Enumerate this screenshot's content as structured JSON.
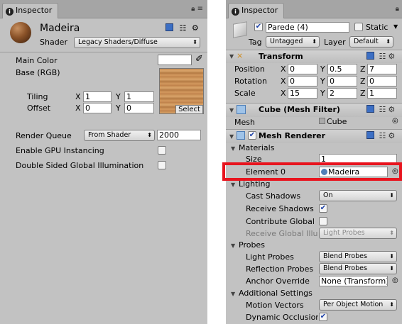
{
  "left": {
    "tab_label": "Inspector",
    "material": {
      "name": "Madeira",
      "shader_label": "Shader",
      "shader_value": "Legacy Shaders/Diffuse"
    },
    "main_color_label": "Main Color",
    "base_label": "Base (RGB)",
    "tiling_label": "Tiling",
    "offset_label": "Offset",
    "x_label": "X",
    "y_label": "Y",
    "tiling_x": "1",
    "tiling_y": "1",
    "offset_x": "0",
    "offset_y": "0",
    "select_label": "Select",
    "render_queue_label": "Render Queue",
    "render_queue_mode": "From Shader",
    "render_queue_value": "2000",
    "gpu_instancing_label": "Enable GPU Instancing",
    "double_sided_label": "Double Sided Global Illumination"
  },
  "right": {
    "tab_label": "Inspector",
    "object_name": "Parede (4)",
    "static_label": "Static",
    "tag_label": "Tag",
    "tag_value": "Untagged",
    "layer_label": "Layer",
    "layer_value": "Default",
    "transform": {
      "title": "Transform",
      "position_label": "Position",
      "rotation_label": "Rotation",
      "scale_label": "Scale",
      "x_label": "X",
      "y_label": "Y",
      "z_label": "Z",
      "position": {
        "x": "0",
        "y": "0.5",
        "z": "7"
      },
      "rotation": {
        "x": "0",
        "y": "0",
        "z": "0"
      },
      "scale": {
        "x": "15",
        "y": "2",
        "z": "1"
      }
    },
    "mesh_filter": {
      "title": "Cube (Mesh Filter)",
      "mesh_label": "Mesh",
      "mesh_value": "Cube"
    },
    "mesh_renderer": {
      "title": "Mesh Renderer",
      "materials_label": "Materials",
      "size_label": "Size",
      "size_value": "1",
      "element0_label": "Element 0",
      "element0_value": "Madeira",
      "lighting_label": "Lighting",
      "cast_shadows_label": "Cast Shadows",
      "cast_shadows_value": "On",
      "receive_shadows_label": "Receive Shadows",
      "contribute_global_label": "Contribute Global",
      "receive_global_label": "Receive Global Illu",
      "receive_global_value": "Light Probes",
      "probes_label": "Probes",
      "light_probes_label": "Light Probes",
      "light_probes_value": "Blend Probes",
      "reflection_probes_label": "Reflection Probes",
      "reflection_probes_value": "Blend Probes",
      "anchor_override_label": "Anchor Override",
      "anchor_override_value": "None (Transform)",
      "additional_settings_label": "Additional Settings",
      "motion_vectors_label": "Motion Vectors",
      "motion_vectors_value": "Per Object Motion",
      "dynamic_occlusion_label": "Dynamic Occlusion"
    }
  },
  "highlight_color": "#e8141e"
}
